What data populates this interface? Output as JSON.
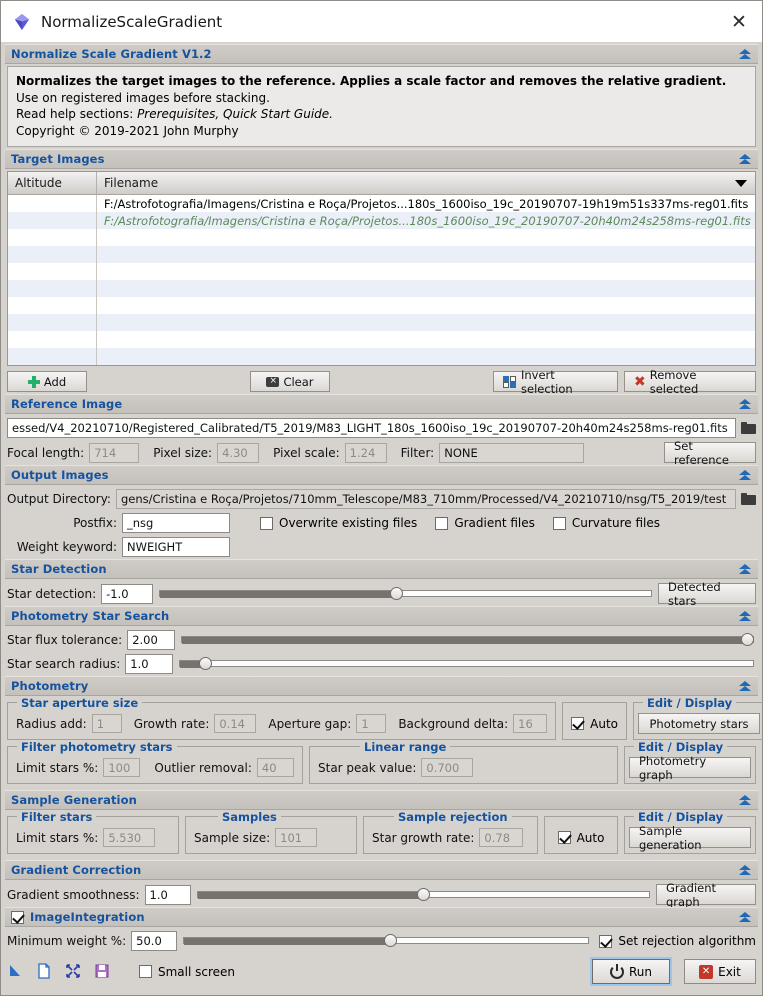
{
  "window": {
    "title": "NormalizeScaleGradient",
    "app_icon": "gem-icon",
    "close_icon": "close-icon"
  },
  "header": {
    "title": "Normalize Scale Gradient V1.2",
    "collapse_icon": "collapse-up-icon",
    "description": {
      "line1": "Normalizes the target images to the reference. Applies a scale factor and removes the relative gradient.",
      "line2": "Use on registered images before stacking.",
      "line3_prefix": "Read help sections: ",
      "line3_links": "Prerequisites, Quick Start Guide.",
      "line4": "Copyright © 2019-2021 John Murphy"
    }
  },
  "target_images": {
    "section_title": "Target Images",
    "columns": [
      "Altitude",
      "Filename"
    ],
    "sort_icon": "sort-descending-icon",
    "rows": [
      {
        "altitude": "",
        "filename": "F:/Astrofotografia/Imagens/Cristina e Roça/Projetos...180s_1600iso_19c_20190707-19h19m51s337ms-reg01.fits",
        "is_reference": false
      },
      {
        "altitude": "",
        "filename": "F:/Astrofotografia/Imagens/Cristina e Roça/Projetos...180s_1600iso_19c_20190707-20h40m24s258ms-reg01.fits",
        "is_reference": true
      }
    ],
    "buttons": {
      "add": "Add",
      "clear": "Clear",
      "invert": "Invert selection",
      "remove": "Remove selected"
    }
  },
  "reference_image": {
    "section_title": "Reference Image",
    "path": "essed/V4_20210710/Registered_Calibrated/T5_2019/M83_LIGHT_180s_1600iso_19c_20190707-20h40m24s258ms-reg01.fits",
    "browse_icon": "folder-icon",
    "focal_length_label": "Focal length:",
    "focal_length": "714",
    "pixel_size_label": "Pixel size:",
    "pixel_size": "4.30",
    "pixel_scale_label": "Pixel scale:",
    "pixel_scale": "1.24",
    "filter_label": "Filter:",
    "filter": "NONE",
    "set_reference": "Set reference"
  },
  "output_images": {
    "section_title": "Output Images",
    "directory_label": "Output Directory:",
    "directory": "gens/Cristina e Roça/Projetos/710mm_Telescope/M83_710mm/Processed/V4_20210710/nsg/T5_2019/test",
    "browse_icon": "folder-icon",
    "postfix_label": "Postfix:",
    "postfix": "_nsg",
    "overwrite_label": "Overwrite existing files",
    "overwrite_checked": false,
    "gradient_files_label": "Gradient files",
    "gradient_files_checked": false,
    "curvature_files_label": "Curvature files",
    "curvature_files_checked": false,
    "weight_keyword_label": "Weight keyword:",
    "weight_keyword": "NWEIGHT"
  },
  "star_detection": {
    "section_title": "Star Detection",
    "label": "Star detection:",
    "value": "-1.0",
    "slider_percent": 48,
    "button": "Detected stars"
  },
  "photometry_star_search": {
    "section_title": "Photometry Star Search",
    "flux_tolerance_label": "Star flux tolerance:",
    "flux_tolerance": "2.00",
    "flux_slider_percent": 100,
    "search_radius_label": "Star search radius:",
    "search_radius": "1.0",
    "radius_slider_percent": 4
  },
  "photometry": {
    "section_title": "Photometry",
    "aperture_group": "Star aperture size",
    "radius_add_label": "Radius add:",
    "radius_add": "1",
    "growth_rate_label": "Growth rate:",
    "growth_rate": "0.14",
    "aperture_gap_label": "Aperture gap:",
    "aperture_gap": "1",
    "background_delta_label": "Background delta:",
    "background_delta": "16",
    "auto_label": "Auto",
    "auto_checked": true,
    "edit_display_1": "Edit / Display",
    "photometry_stars_button": "Photometry stars",
    "filter_group": "Filter photometry stars",
    "limit_stars_label": "Limit stars %:",
    "limit_stars": "100",
    "outlier_removal_label": "Outlier removal:",
    "outlier_removal": "40",
    "linear_range_group": "Linear range",
    "star_peak_label": "Star peak value:",
    "star_peak": "0.700",
    "edit_display_2": "Edit / Display",
    "photometry_graph_button": "Photometry graph"
  },
  "sample_generation": {
    "section_title": "Sample Generation",
    "filter_group": "Filter stars",
    "limit_stars_label": "Limit stars %:",
    "limit_stars": "5.530",
    "samples_group": "Samples",
    "sample_size_label": "Sample size:",
    "sample_size": "101",
    "rejection_group": "Sample rejection",
    "star_growth_label": "Star growth rate:",
    "star_growth": "0.78",
    "auto_label": "Auto",
    "auto_checked": true,
    "edit_display": "Edit / Display",
    "button": "Sample generation"
  },
  "gradient_correction": {
    "section_title": "Gradient Correction",
    "label": "Gradient smoothness:",
    "value": "1.0",
    "slider_percent": 50,
    "button": "Gradient graph"
  },
  "image_integration": {
    "section_title": "ImageIntegration",
    "enabled": true,
    "min_weight_label": "Minimum weight %:",
    "min_weight": "50.0",
    "slider_percent": 51,
    "rejection_label": "Set rejection algorithm",
    "rejection_checked": true
  },
  "bottom_bar": {
    "icons": [
      "arrow-cursor-icon",
      "new-document-icon",
      "reset-icon",
      "save-icon"
    ],
    "small_screen_label": "Small screen",
    "small_screen_checked": false,
    "run_label": "Run",
    "exit_label": "Exit"
  },
  "colors": {
    "section_title": "#15539e",
    "reference_row": "#5b8a5b",
    "accent": "#1f69b8",
    "background": "#d6d2ce"
  }
}
